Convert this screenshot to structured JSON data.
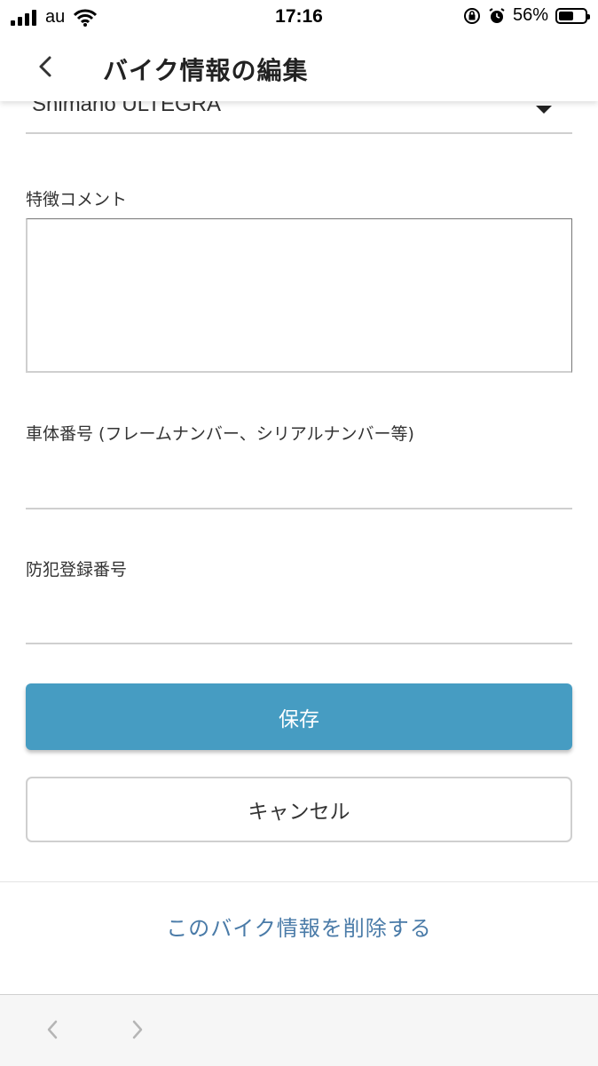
{
  "status_bar": {
    "carrier": "au",
    "time": "17:16",
    "battery_percent": "56%",
    "battery_level": 0.56,
    "icons": [
      "signal-icon",
      "wifi-icon",
      "orientation-lock-icon",
      "alarm-icon",
      "battery-icon"
    ]
  },
  "header": {
    "title": "バイク情報の編集",
    "back_icon": "chevron-left-icon"
  },
  "form": {
    "component_select_value": "Shimano ULTEGRA",
    "comment_label": "特徴コメント",
    "comment_value": "",
    "frame_number_label": "車体番号 (フレームナンバー、シリアルナンバー等)",
    "frame_number_value": "",
    "crime_prevention_label": "防犯登録番号",
    "crime_prevention_value": ""
  },
  "actions": {
    "save_label": "保存",
    "cancel_label": "キャンセル",
    "delete_label": "このバイク情報を削除する"
  },
  "colors": {
    "accent": "#469cc2",
    "link": "#4a7ba8"
  },
  "bottom_bar": {
    "back_icon": "chevron-left-icon",
    "forward_icon": "chevron-right-icon"
  }
}
